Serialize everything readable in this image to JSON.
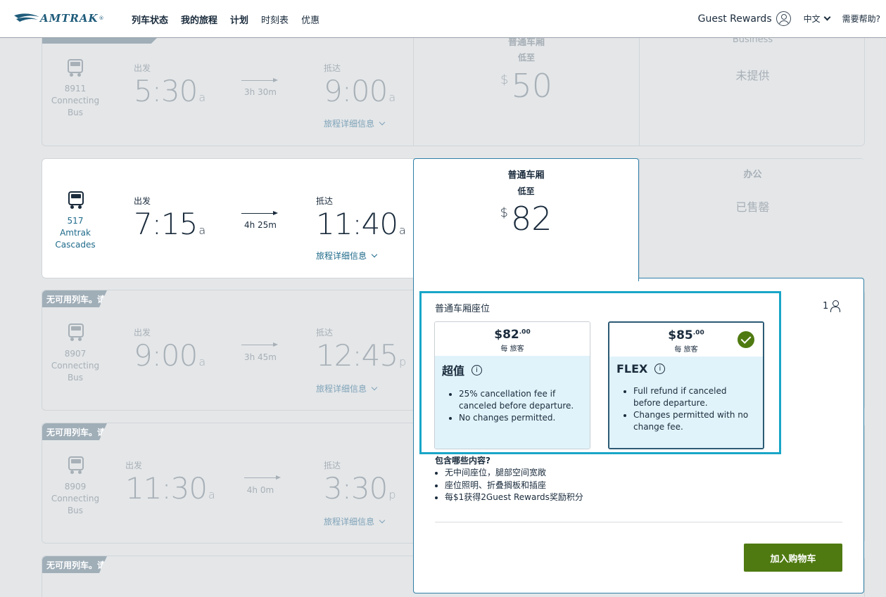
{
  "header": {
    "logo": "AMTRAK",
    "nav": [
      "列车状态",
      "我的旅程",
      "计划",
      "时刻表",
      "优惠"
    ],
    "guest_rewards": "Guest Rewards",
    "language": "中文",
    "help": "需要帮助?"
  },
  "labels": {
    "depart": "出发",
    "arrive": "抵达",
    "details": "旅程详细信息",
    "coach": "普通车厢",
    "from": "低至",
    "business": "Business",
    "business_cn": "办公",
    "not_offered": "未提供",
    "sold_out": "已售罄",
    "unavailable": "无可用列车。请"
  },
  "trips": [
    {
      "num": "8911",
      "name": "Connecting Bus",
      "dep": "5:30",
      "dep_ap": "a",
      "dur": "3h 30m",
      "arr": "9:00",
      "arr_ap": "a",
      "coach_price": "50"
    },
    {
      "num": "517",
      "name": "Amtrak Cascades",
      "dep": "7:15",
      "dep_ap": "a",
      "dur": "4h 25m",
      "arr": "11:40",
      "arr_ap": "a",
      "coach_price": "82"
    },
    {
      "num": "8907",
      "name": "Connecting Bus",
      "dep": "9:00",
      "dep_ap": "a",
      "dur": "3h 45m",
      "arr": "12:45",
      "arr_ap": "p"
    },
    {
      "num": "8909",
      "name": "Connecting Bus",
      "dep": "11:30",
      "dep_ap": "a",
      "dur": "4h 0m",
      "arr": "3:30",
      "arr_ap": "p"
    }
  ],
  "panel": {
    "title": "普通车厢座位",
    "passengers": "1",
    "fares": [
      {
        "price": "$82",
        "cents": ".00",
        "per": "每 旅客",
        "name": "超值",
        "bullets": [
          "25% cancellation fee if canceled before departure.",
          "No changes permitted."
        ],
        "selected": false
      },
      {
        "price": "$85",
        "cents": ".00",
        "per": "每 旅客",
        "name": "FLEX",
        "bullets": [
          "Full refund if canceled before departure.",
          "Changes permitted with no change fee."
        ],
        "selected": true
      }
    ],
    "includes_title": "包含哪些内容?",
    "includes": [
      "无中间座位，腿部空间宽敞",
      "座位照明、折叠搁板和插座",
      "每$1获得2Guest Rewards奖励积分"
    ],
    "add_to_cart": "加入购物车"
  },
  "colors": {
    "brand": "#1e5b7a",
    "accent_green": "#4f7a11",
    "highlight": "#19a6c8",
    "panel_border": "#2e7fa6"
  }
}
